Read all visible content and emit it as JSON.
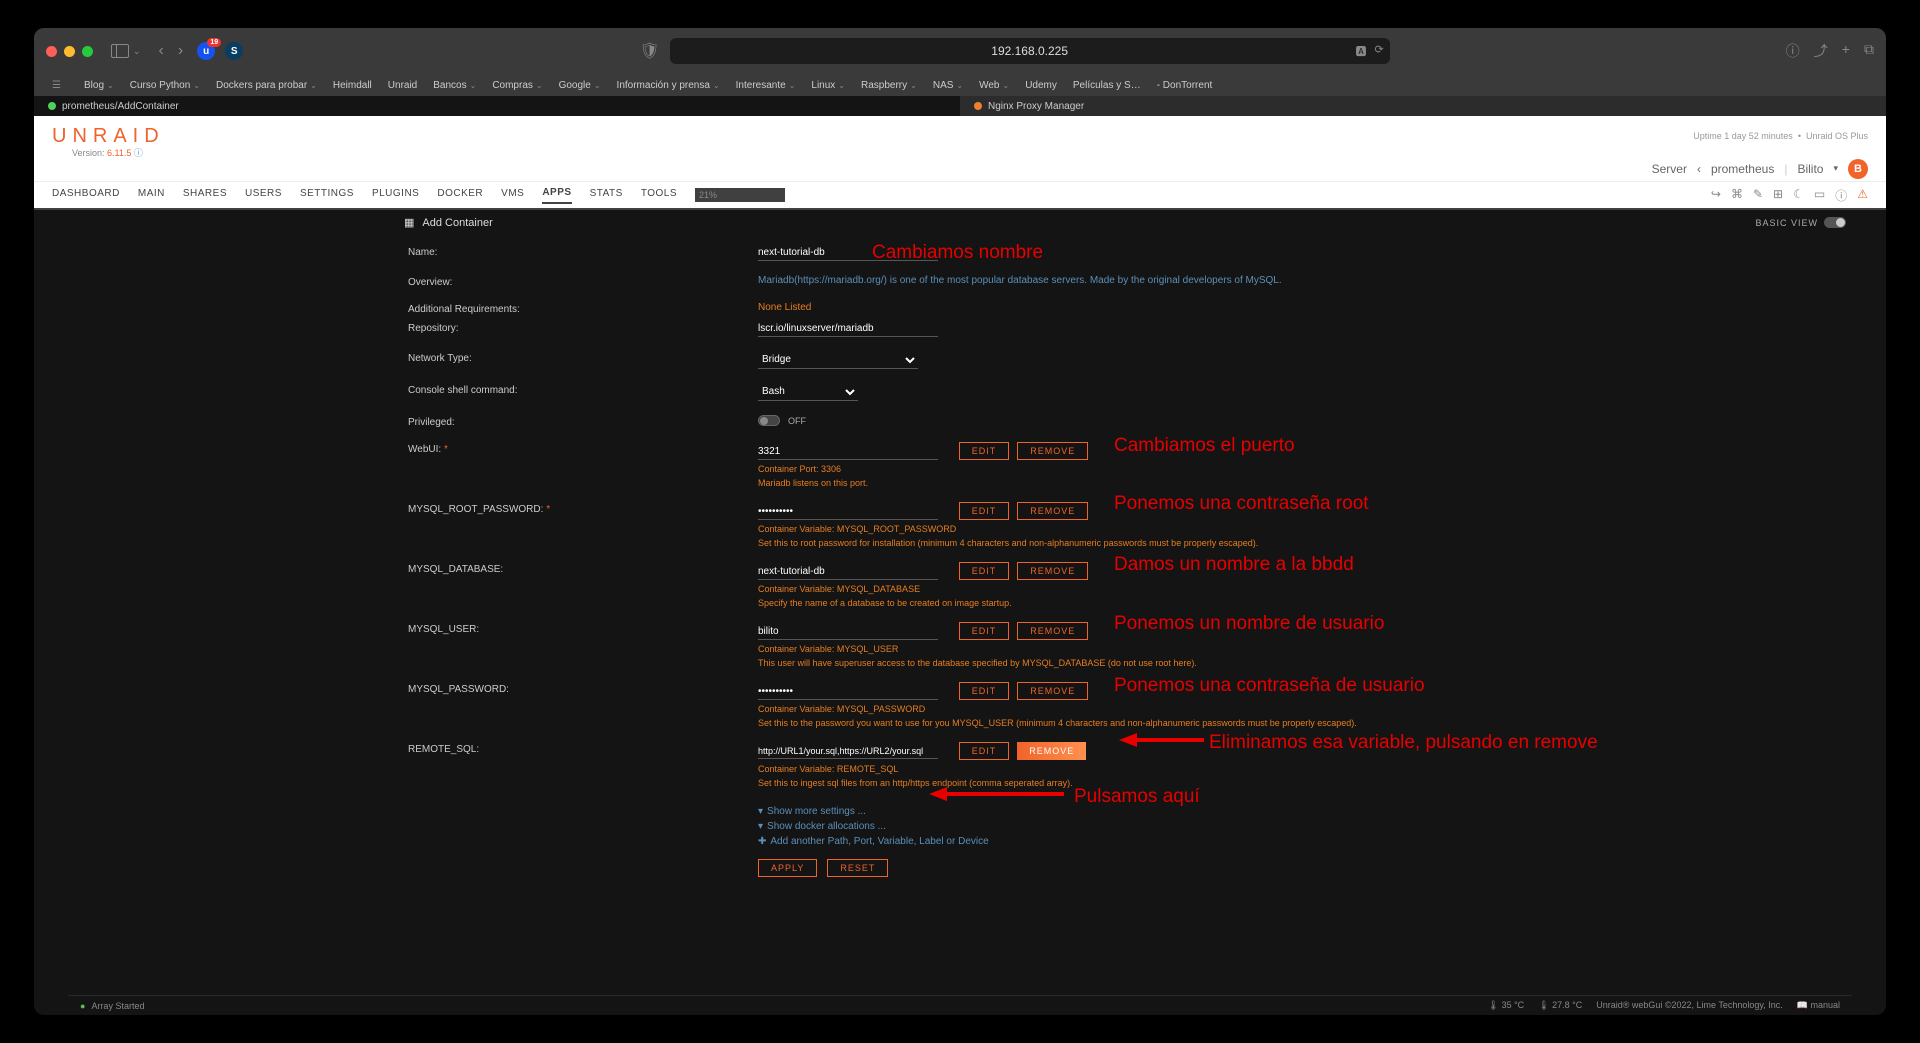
{
  "browser": {
    "url": "192.168.0.225",
    "ext_badge": "19",
    "bookmarks": [
      {
        "label": "Blog",
        "dd": true
      },
      {
        "label": "Curso Python",
        "dd": true
      },
      {
        "label": "Dockers para probar",
        "dd": true
      },
      {
        "label": "Heimdall",
        "dd": false
      },
      {
        "label": "Unraid",
        "dd": false
      },
      {
        "label": "Bancos",
        "dd": true
      },
      {
        "label": "Compras",
        "dd": true
      },
      {
        "label": "Google",
        "dd": true
      },
      {
        "label": "Información y prensa",
        "dd": true
      },
      {
        "label": "Interesante",
        "dd": true
      },
      {
        "label": "Linux",
        "dd": true
      },
      {
        "label": "Raspberry",
        "dd": true
      },
      {
        "label": "NAS",
        "dd": true
      },
      {
        "label": "Web",
        "dd": true
      },
      {
        "label": "Udemy",
        "dd": false
      },
      {
        "label": "Películas y S…",
        "dd": false
      },
      {
        "label": "- DonTorrent",
        "dd": false
      }
    ],
    "tabs": [
      {
        "label": "prometheus/AddContainer",
        "active": true,
        "dot": "g"
      },
      {
        "label": "Nginx Proxy Manager",
        "active": false,
        "dot": "o"
      }
    ]
  },
  "header": {
    "brand": "UNRAID",
    "version_prefix": "Version: ",
    "version": "6.11.5",
    "uptime": "Uptime 1 day 52 minutes",
    "os": "Unraid OS Plus",
    "server_label": "Server",
    "server_name": "prometheus",
    "user": "Bilito",
    "avatar": "B"
  },
  "nav": {
    "items": [
      "DASHBOARD",
      "MAIN",
      "SHARES",
      "USERS",
      "SETTINGS",
      "PLUGINS",
      "DOCKER",
      "VMS",
      "APPS",
      "STATS",
      "TOOLS"
    ],
    "active": "APPS",
    "disk": "21%"
  },
  "page": {
    "title": "Add Container",
    "view_label": "BASIC VIEW"
  },
  "form": {
    "name": {
      "label": "Name:",
      "value": "next-tutorial-db"
    },
    "overview": {
      "label": "Overview:",
      "text_pre": "Mariadb(",
      "link": "https://mariadb.org/",
      "text_post": ") is one of the most popular database servers. Made by the original developers of MySQL."
    },
    "addreq": {
      "label": "Additional Requirements:",
      "value": "None Listed"
    },
    "repo": {
      "label": "Repository:",
      "value": "lscr.io/linuxserver/mariadb"
    },
    "nettype": {
      "label": "Network Type:",
      "value": "Bridge"
    },
    "shell": {
      "label": "Console shell command:",
      "value": "Bash"
    },
    "priv": {
      "label": "Privileged:",
      "value": "OFF"
    },
    "webui": {
      "label": "WebUI:",
      "value": "3321",
      "var": "Container Port: 3306",
      "desc": "Mariadb listens on this port."
    },
    "rootpw": {
      "label": "MYSQL_ROOT_PASSWORD:",
      "value": "••••••••••",
      "var": "Container Variable: MYSQL_ROOT_PASSWORD",
      "desc": "Set this to root password for installation (minimum 4 characters and non-alphanumeric passwords must be properly escaped)."
    },
    "db": {
      "label": "MYSQL_DATABASE:",
      "value": "next-tutorial-db",
      "var": "Container Variable: MYSQL_DATABASE",
      "desc": "Specify the name of a database to be created on image startup."
    },
    "user": {
      "label": "MYSQL_USER:",
      "value": "bilito",
      "var": "Container Variable: MYSQL_USER",
      "desc": "This user will have superuser access to the database specified by MYSQL_DATABASE (do not use root here)."
    },
    "userpw": {
      "label": "MYSQL_PASSWORD:",
      "value": "••••••••••",
      "var": "Container Variable: MYSQL_PASSWORD",
      "desc": "Set this to the password you want to use for you MYSQL_USER (minimum 4 characters and non-alphanumeric passwords must be properly escaped)."
    },
    "remote": {
      "label": "REMOTE_SQL:",
      "value": "http://URL1/your.sql,https://URL2/your.sql",
      "var": "Container Variable: REMOTE_SQL",
      "desc": "Set this to ingest sql files from an http/https endpoint (comma seperated array)."
    },
    "edit": "EDIT",
    "remove": "REMOVE",
    "show_more": "Show more settings ...",
    "show_docker": "Show docker allocations ...",
    "add_another": "Add another Path, Port, Variable, Label or Device",
    "apply": "APPLY",
    "reset": "RESET"
  },
  "footer": {
    "array": "Array Started",
    "temp1": "🌡 35 °C",
    "temp2": "🌡 27.8 °C",
    "copy": "Unraid® webGui ©2022, Lime Technology, Inc.",
    "manual": "📖 manual"
  },
  "annotations": {
    "a1": "Cambiamos nombre",
    "a2": "Cambiamos el puerto",
    "a3": "Ponemos una contraseña root",
    "a4": "Damos un nombre a la bbdd",
    "a5": "Ponemos un nombre de usuario",
    "a6": "Ponemos una contraseña de usuario",
    "a7": "Eliminamos esa variable, pulsando en remove",
    "a8": "Pulsamos aquí"
  }
}
